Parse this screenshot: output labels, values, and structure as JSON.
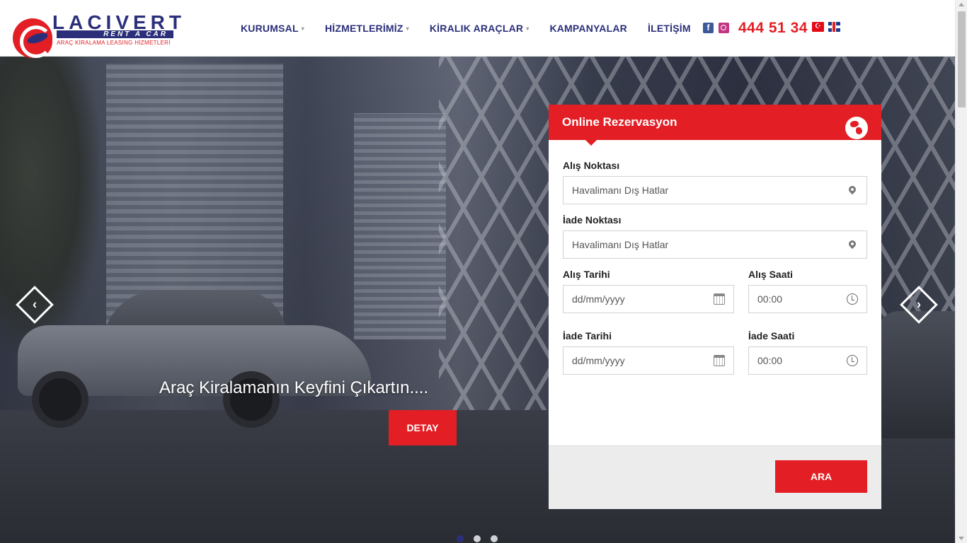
{
  "brand": {
    "name": "LACIVERT",
    "sub": "RENT A CAR",
    "tagline": "ARAÇ KİRALAMA LEASING HİZMETLERİ",
    "colors": {
      "primary": "#2b2f7a",
      "accent": "#e31e24"
    }
  },
  "nav": {
    "items": [
      {
        "label": "KURUMSAL",
        "has_dropdown": true
      },
      {
        "label": "HİZMETLERİMİZ",
        "has_dropdown": true
      },
      {
        "label": "KİRALIK ARAÇLAR",
        "has_dropdown": true
      },
      {
        "label": "KAMPANYALAR",
        "has_dropdown": false
      },
      {
        "label": "İLETİŞİM",
        "has_dropdown": false
      }
    ],
    "caret": "▾",
    "social": [
      {
        "icon": "facebook-icon",
        "glyph": "f"
      },
      {
        "icon": "instagram-icon",
        "glyph": ""
      }
    ],
    "phone": "444 51 34",
    "languages": [
      {
        "icon": "turkish-flag-icon",
        "glyph": "☪"
      },
      {
        "icon": "english-flag-icon",
        "glyph": ""
      }
    ]
  },
  "hero": {
    "title": "Araç Kiralamanın Keyfini Çıkartın....",
    "button": "DETAY",
    "prev_glyph": "‹",
    "next_glyph": "›",
    "slides": 3,
    "active_slide": 1
  },
  "reservation": {
    "title": "Online Rezervasyon",
    "pickup_label": "Alış Noktası",
    "pickup_value": "Havalimanı Dış Hatlar",
    "return_label": "İade Noktası",
    "return_value": "Havalimanı Dış Hatlar",
    "pickup_date_label": "Alış Tarihi",
    "pickup_date_placeholder": "dd/mm/yyyy",
    "pickup_time_label": "Alış Saati",
    "pickup_time_value": "00:00",
    "return_date_label": "İade Tarihi",
    "return_date_placeholder": "dd/mm/yyyy",
    "return_time_label": "İade Saati",
    "return_time_value": "00:00",
    "search_button": "ARA"
  }
}
